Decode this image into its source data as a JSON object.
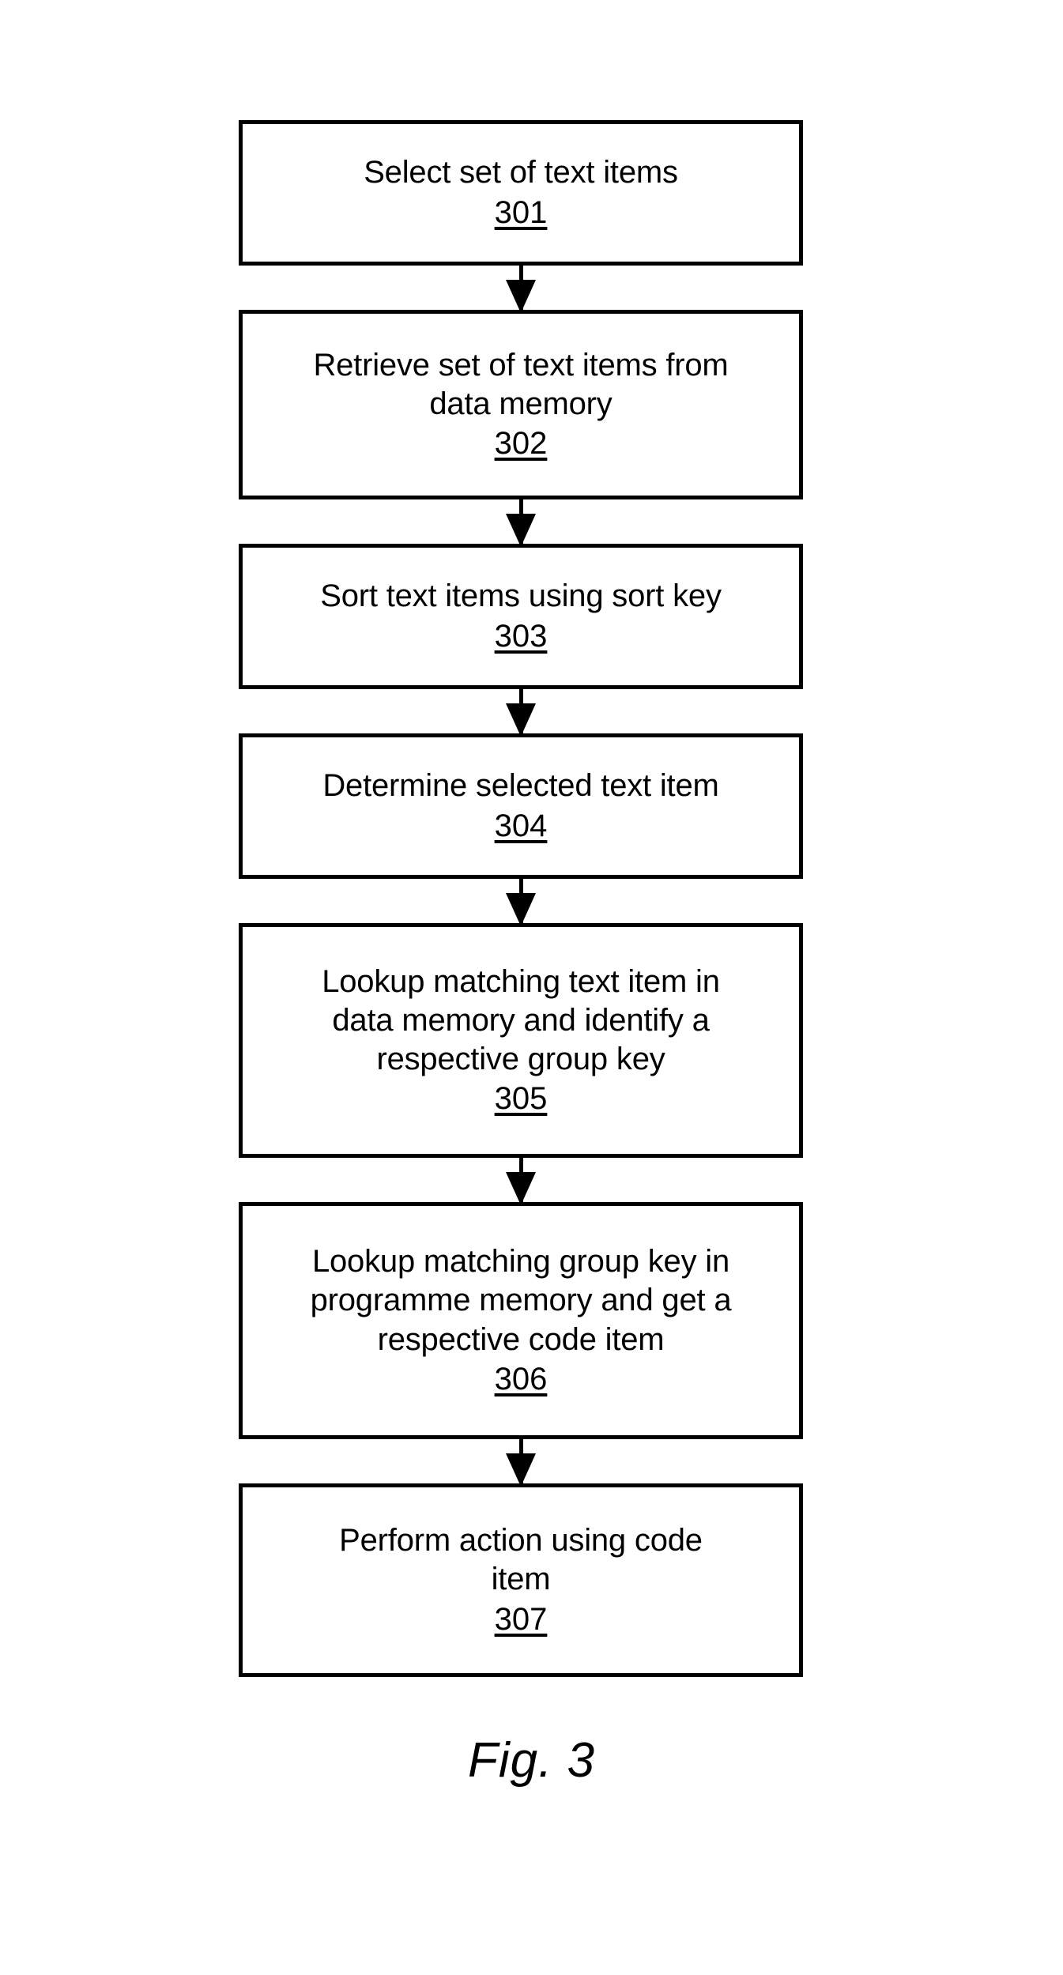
{
  "figure": {
    "caption": "Fig. 3",
    "type": "patent-flowchart",
    "orientation": "vertical"
  },
  "flowchart": {
    "steps": [
      {
        "text": "Select set of text items",
        "number": "301"
      },
      {
        "text": "Retrieve set of text items from\ndata memory",
        "number": "302"
      },
      {
        "text": "Sort text items using sort key",
        "number": "303"
      },
      {
        "text": "Determine selected text item",
        "number": "304"
      },
      {
        "text": "Lookup matching text item in\ndata memory and identify a\nrespective group key",
        "number": "305"
      },
      {
        "text": "Lookup matching group key in\nprogramme memory and get a\nrespective code item",
        "number": "306"
      },
      {
        "text": "Perform action using code\nitem",
        "number": "307"
      }
    ],
    "connectors": [
      {
        "from": "301",
        "to": "302",
        "kind": "arrow-down"
      },
      {
        "from": "302",
        "to": "303",
        "kind": "arrow-down"
      },
      {
        "from": "303",
        "to": "304",
        "kind": "arrow-down"
      },
      {
        "from": "304",
        "to": "305",
        "kind": "arrow-down"
      },
      {
        "from": "305",
        "to": "306",
        "kind": "arrow-down"
      },
      {
        "from": "306",
        "to": "307",
        "kind": "arrow-down"
      }
    ],
    "colors": {
      "stroke": "#000000",
      "fill": "#ffffff",
      "text": "#000000"
    }
  }
}
